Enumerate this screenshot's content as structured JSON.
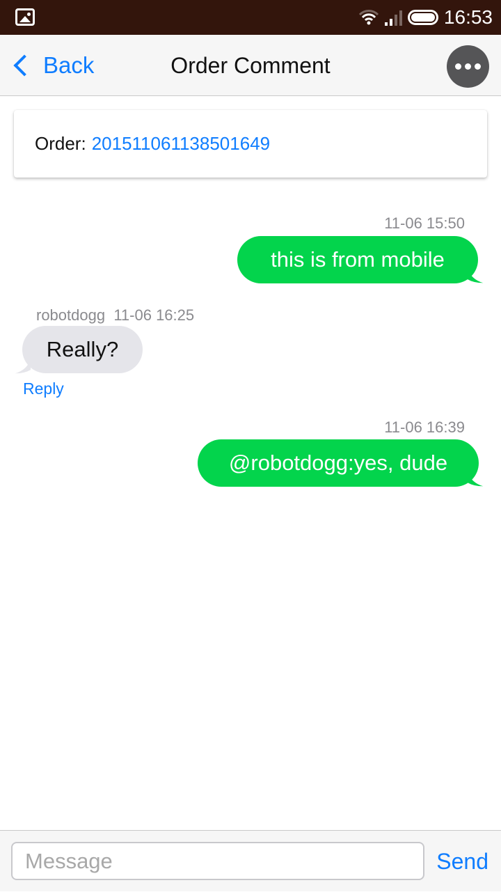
{
  "status_bar": {
    "left_icon": "gallery-icon",
    "icons": [
      "wifi-icon",
      "signal-icon",
      "battery-icon"
    ],
    "time": "16:53"
  },
  "nav": {
    "back_label": "Back",
    "title": "Order Comment",
    "more_icon": "more-horizontal-icon"
  },
  "order": {
    "label": "Order:",
    "number": "201511061138501649"
  },
  "messages": [
    {
      "direction": "outgoing",
      "time": "11-06 15:50",
      "text": "this is from mobile"
    },
    {
      "direction": "incoming",
      "author": "robotdogg",
      "time": "11-06 16:25",
      "text": "Really?",
      "reply_label": "Reply"
    },
    {
      "direction": "outgoing",
      "time": "11-06 16:39",
      "text": "@robotdogg:yes, dude"
    }
  ],
  "composer": {
    "value": "",
    "placeholder": "Message",
    "send_label": "Send"
  },
  "colors": {
    "accent": "#0f7dff",
    "outgoing_bubble": "#03d44c",
    "incoming_bubble": "#e5e5ea",
    "status_bar": "#33150c"
  }
}
